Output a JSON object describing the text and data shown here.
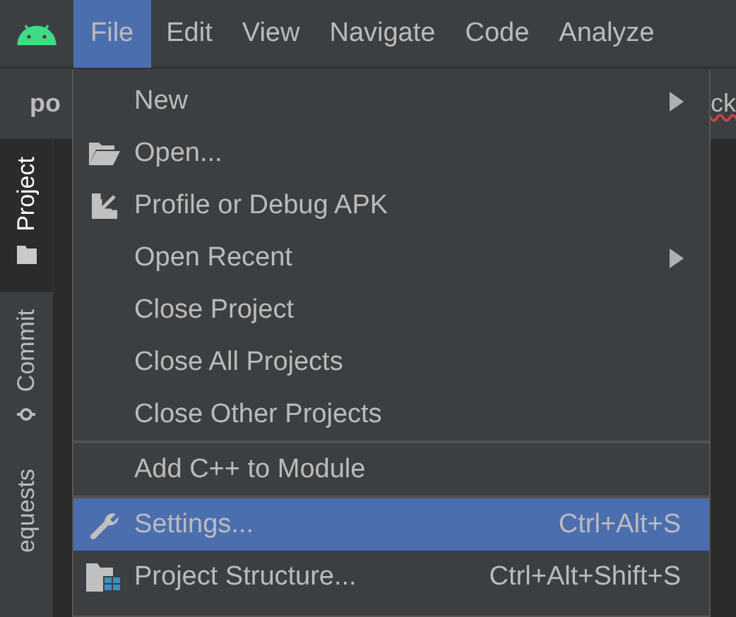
{
  "menu_bar": {
    "items": [
      {
        "label": "File",
        "selected": true
      },
      {
        "label": "Edit",
        "selected": false
      },
      {
        "label": "View",
        "selected": false
      },
      {
        "label": "Navigate",
        "selected": false
      },
      {
        "label": "Code",
        "selected": false
      },
      {
        "label": "Analyze",
        "selected": false
      }
    ]
  },
  "editor_tabs": [
    "po",
    "ck"
  ],
  "tool_window_tabs": [
    {
      "label": "Project",
      "kind": "folder",
      "selected": true
    },
    {
      "label": "Commit",
      "kind": "commit",
      "selected": false
    },
    {
      "label": "equests",
      "kind": "none",
      "selected": false
    }
  ],
  "file_menu": {
    "groups": [
      {
        "items": [
          {
            "label": "New",
            "kind": "none",
            "submenu": true,
            "selected": false
          },
          {
            "label": "Open...",
            "kind": "folder",
            "submenu": false,
            "selected": false
          },
          {
            "label": "Profile or Debug APK",
            "kind": "import",
            "submenu": false,
            "selected": false
          },
          {
            "label": "Open Recent",
            "kind": "none",
            "submenu": true,
            "selected": false
          },
          {
            "label": "Close Project",
            "kind": "none",
            "submenu": false,
            "selected": false
          },
          {
            "label": "Close All Projects",
            "kind": "none",
            "submenu": false,
            "selected": false
          },
          {
            "label": "Close Other Projects",
            "kind": "none",
            "submenu": false,
            "selected": false
          }
        ]
      },
      {
        "items": [
          {
            "label": "Add C++ to Module",
            "kind": "none",
            "submenu": false,
            "selected": false
          }
        ]
      },
      {
        "items": [
          {
            "label": "Settings...",
            "kind": "wrench",
            "submenu": false,
            "shortcut": "Ctrl+Alt+S",
            "selected": true
          },
          {
            "label": "Project Structure...",
            "kind": "structure",
            "submenu": false,
            "shortcut": "Ctrl+Alt+Shift+S",
            "selected": false
          }
        ]
      }
    ]
  }
}
